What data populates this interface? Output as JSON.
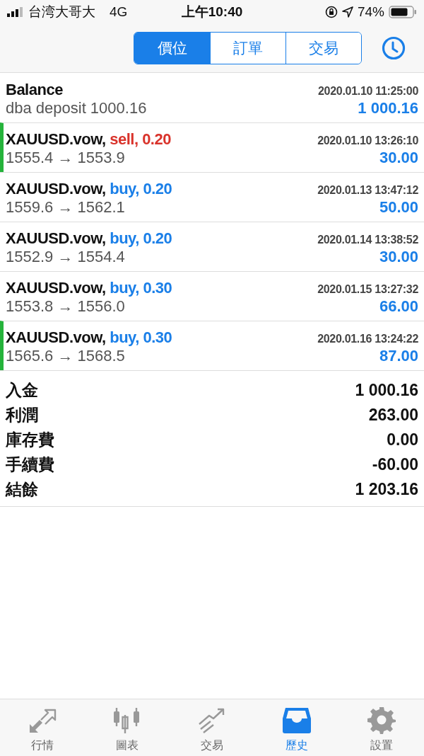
{
  "status_bar": {
    "carrier": "台湾大哥大",
    "network": "4G",
    "time": "上午10:40",
    "battery": "74%"
  },
  "segments": [
    {
      "label": "價位",
      "selected": true
    },
    {
      "label": "訂單",
      "selected": false
    },
    {
      "label": "交易",
      "selected": false
    }
  ],
  "deals": [
    {
      "kind": "balance",
      "title": "Balance",
      "time": "2020.01.10 11:25:00",
      "detail": "dba deposit 1000.16",
      "amount": "1 000.16",
      "marked": false
    },
    {
      "kind": "trade",
      "title": "XAUUSD.vow,",
      "sell": true,
      "action": "sell, 0.20",
      "time": "2020.01.10 13:26:10",
      "detail": "1555.4 → 1553.9",
      "amount": "30.00",
      "marked": true
    },
    {
      "kind": "trade",
      "title": "XAUUSD.vow,",
      "sell": false,
      "action": "buy, 0.20",
      "time": "2020.01.13 13:47:12",
      "detail": "1559.6 → 1562.1",
      "amount": "50.00",
      "marked": false
    },
    {
      "kind": "trade",
      "title": "XAUUSD.vow,",
      "sell": false,
      "action": "buy, 0.20",
      "time": "2020.01.14 13:38:52",
      "detail": "1552.9 → 1554.4",
      "amount": "30.00",
      "marked": false
    },
    {
      "kind": "trade",
      "title": "XAUUSD.vow,",
      "sell": false,
      "action": "buy, 0.30",
      "time": "2020.01.15 13:27:32",
      "detail": "1553.8 → 1556.0",
      "amount": "66.00",
      "marked": false
    },
    {
      "kind": "trade",
      "title": "XAUUSD.vow,",
      "sell": false,
      "action": "buy, 0.30",
      "time": "2020.01.16 13:24:22",
      "detail": "1565.6 → 1568.5",
      "amount": "87.00",
      "marked": true
    }
  ],
  "summary": [
    {
      "label": "入金",
      "value": "1 000.16"
    },
    {
      "label": "利潤",
      "value": "263.00"
    },
    {
      "label": "庫存費",
      "value": "0.00"
    },
    {
      "label": "手續費",
      "value": "-60.00"
    },
    {
      "label": "結餘",
      "value": "1 203.16"
    }
  ],
  "tab_bar": [
    {
      "kind": "quotes",
      "label": "行情",
      "selected": false
    },
    {
      "kind": "chart",
      "label": "圖表",
      "selected": false
    },
    {
      "kind": "trade",
      "label": "交易",
      "selected": false
    },
    {
      "kind": "history",
      "label": "歷史",
      "selected": true
    },
    {
      "kind": "settings",
      "label": "設置",
      "selected": false
    }
  ]
}
